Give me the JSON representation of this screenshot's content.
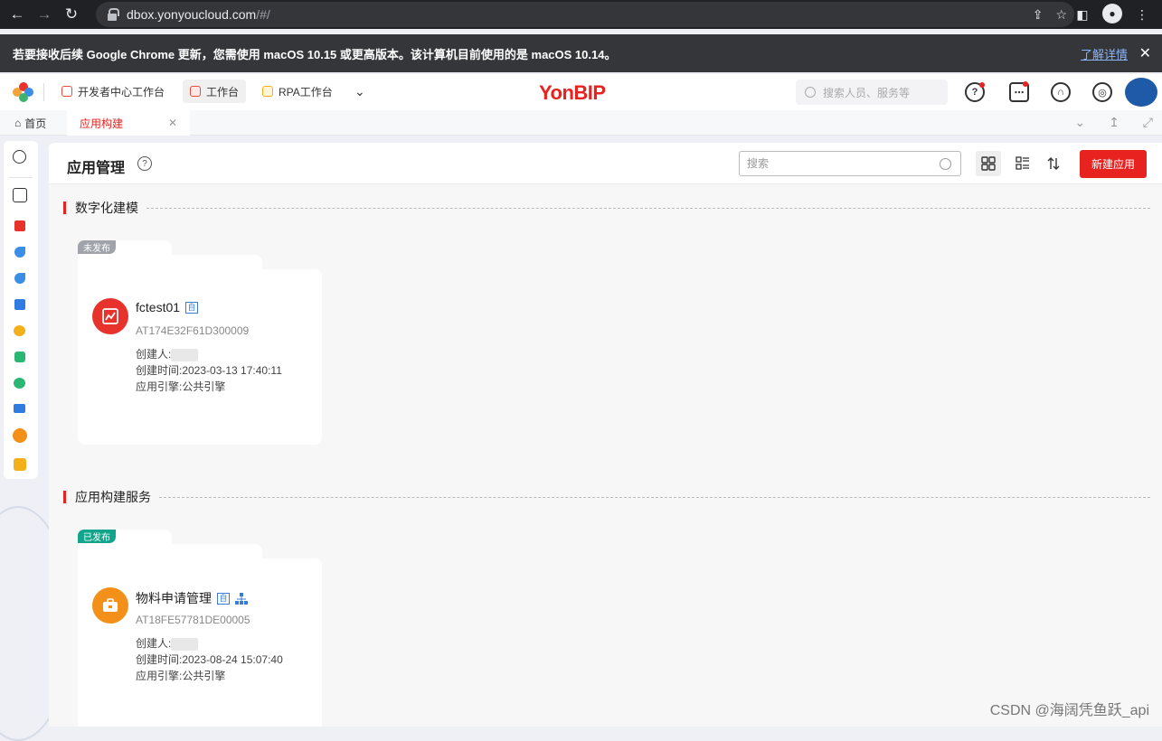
{
  "browser": {
    "url_host": "dbox.yonyoucloud.com",
    "url_path": "/#/",
    "update_message": "若要接收后续 Google Chrome 更新，您需使用 macOS 10.15 或更高版本。该计算机目前使用的是 macOS 10.14。",
    "update_link": "了解详情"
  },
  "topbar": {
    "workbench_tabs": [
      {
        "label": "开发者中心工作台"
      },
      {
        "label": "工作台"
      },
      {
        "label": "RPA工作台"
      }
    ],
    "brand": "YonBIP",
    "search_placeholder": "搜索人员、服务等"
  },
  "page_tabs": [
    {
      "label": "首页"
    },
    {
      "label": "应用构建"
    }
  ],
  "header": {
    "title": "应用管理",
    "search_placeholder": "搜索",
    "create_label": "新建应用"
  },
  "sections": [
    {
      "title": "数字化建模",
      "cards": [
        {
          "status": "未发布",
          "status_color": "#a0a4aa",
          "name": "fctest01",
          "tag": "自",
          "code": "AT174E32F61D300009",
          "creator_label": "创建人:",
          "created_label": "创建时间:2023-03-13 17:40:11",
          "engine_label": "应用引擎:公共引擎",
          "icon_color": "#e8322c"
        }
      ]
    },
    {
      "title": "应用构建服务",
      "cards": [
        {
          "status": "已发布",
          "status_color": "#12a58b",
          "name": "物料申请管理",
          "tag": "自",
          "code": "AT18FE57781DE00005",
          "creator_label": "创建人:",
          "created_label": "创建时间:2023-08-24 15:07:40",
          "engine_label": "应用引擎:公共引擎",
          "icon_color": "#f39019"
        }
      ]
    }
  ],
  "watermark": "CSDN @海阔凭鱼跃_api",
  "colors": {
    "accent": "#e8221f",
    "published": "#12a58b",
    "unpublished": "#a0a4aa"
  }
}
